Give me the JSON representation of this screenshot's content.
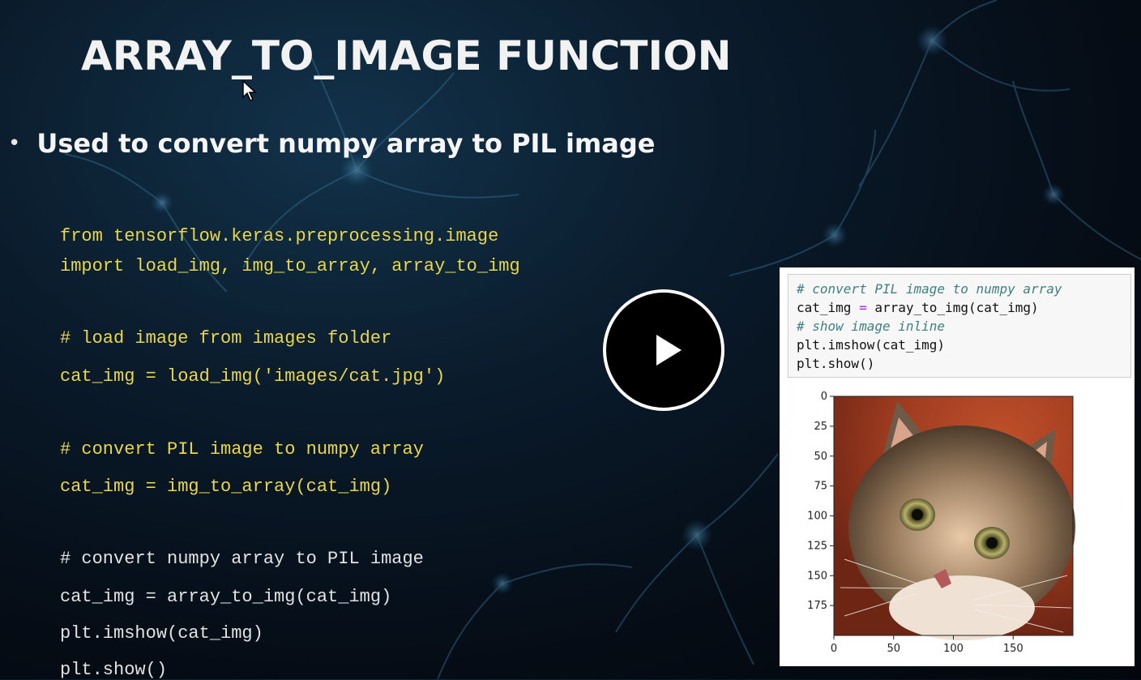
{
  "slide": {
    "title": "ARRAY_TO_IMAGE FUNCTION",
    "bullet": "Used to convert numpy array to PIL image"
  },
  "code_lines": [
    "from tensorflow.keras.preprocessing.image",
    "import load_img, img_to_array, array_to_img",
    "# load image from images folder",
    "cat_img = load_img('images/cat.jpg')",
    "# convert PIL image to numpy array",
    "cat_img = img_to_array(cat_img)",
    "# convert numpy array to PIL image",
    "cat_img = array_to_img(cat_img)",
    "plt.imshow(cat_img)",
    "plt.show()"
  ],
  "notebook": {
    "comment1": "# convert PIL image to numpy array",
    "line2_var": "cat_img",
    "line2_op": "=",
    "line2_call": "array_to_img(cat_img)",
    "comment2": "# show image inline",
    "line4": "plt.imshow(cat_img)",
    "line5": "plt.show()"
  },
  "plot": {
    "y_ticks": [
      "0",
      "25",
      "50",
      "75",
      "100",
      "125",
      "150",
      "175"
    ],
    "x_ticks": [
      "0",
      "50",
      "100",
      "150"
    ],
    "image_subject": "cat photo"
  },
  "video": {
    "play_icon": "play-icon"
  },
  "colors": {
    "code_yellow": "#e9d64a",
    "code_white": "#e2e2e2",
    "title": "#f2f2f2"
  }
}
